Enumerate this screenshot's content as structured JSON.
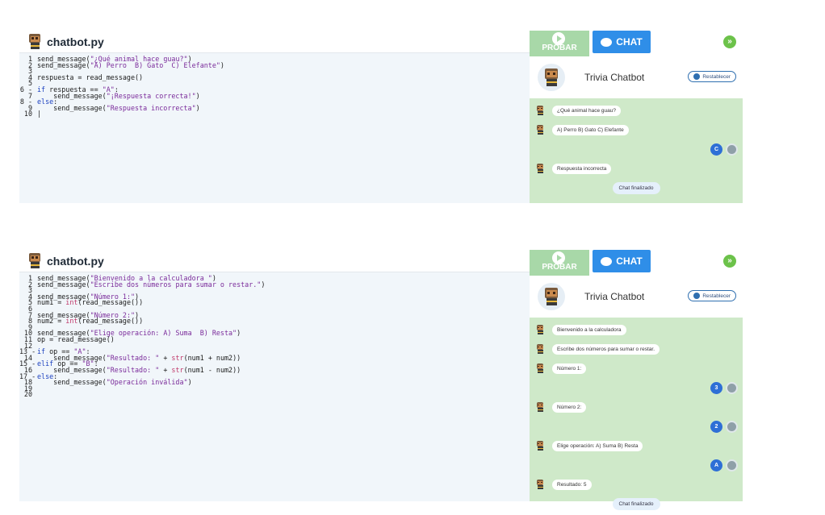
{
  "panels": [
    {
      "file_name": "chatbot.py",
      "code": [
        {
          "n": "1",
          "t": "send_message(\"¿Qué animal hace guau?\")"
        },
        {
          "n": "2",
          "t": "send_message(\"A) Perro  B) Gato  C) Elefante\")"
        },
        {
          "n": "3",
          "t": ""
        },
        {
          "n": "4",
          "t": "respuesta = read_message()"
        },
        {
          "n": "5",
          "t": ""
        },
        {
          "n": "6 -",
          "t": "if respuesta == \"A\":"
        },
        {
          "n": "7",
          "t": "    send_message(\"¡Respuesta correcta!\")"
        },
        {
          "n": "8 -",
          "t": "else:"
        },
        {
          "n": "9",
          "t": "    send_message(\"Respuesta incorrecta\")"
        },
        {
          "n": "10",
          "t": "|"
        }
      ],
      "probar_label": "PROBAR",
      "chat_tab_label": "CHAT",
      "next_icon": "»",
      "bot_title": "Trivia Chatbot",
      "reset_label": "Restablecer",
      "messages": [
        {
          "from": "bot",
          "text": "¿Qué animal hace guau?"
        },
        {
          "from": "bot",
          "text": "A) Perro B) Gato C) Elefante"
        },
        {
          "from": "user",
          "text": "C"
        },
        {
          "from": "bot",
          "text": "Respuesta incorrecta"
        }
      ],
      "end_label": "Chat finalizado"
    },
    {
      "file_name": "chatbot.py",
      "code": [
        {
          "n": "1",
          "t": "send_message(\"Bienvenido a la calculadora \")"
        },
        {
          "n": "2",
          "t": "send_message(\"Escribe dos números para sumar o restar.\")"
        },
        {
          "n": "3",
          "t": ""
        },
        {
          "n": "4",
          "t": "send_message(\"Número 1:\")"
        },
        {
          "n": "5",
          "t": "num1 = int(read_message())"
        },
        {
          "n": "6",
          "t": ""
        },
        {
          "n": "7",
          "t": "send_message(\"Número 2:\")"
        },
        {
          "n": "8",
          "t": "num2 = int(read_message())"
        },
        {
          "n": "9",
          "t": ""
        },
        {
          "n": "10",
          "t": "send_message(\"Elige operación: A) Suma  B) Resta\")"
        },
        {
          "n": "11",
          "t": "op = read_message()"
        },
        {
          "n": "12",
          "t": ""
        },
        {
          "n": "13 -",
          "t": "if op == \"A\":"
        },
        {
          "n": "14",
          "t": "    send_message(\"Resultado: \" + str(num1 + num2))"
        },
        {
          "n": "15 -",
          "t": "elif op == \"B\":"
        },
        {
          "n": "16",
          "t": "    send_message(\"Resultado: \" + str(num1 - num2))"
        },
        {
          "n": "17 -",
          "t": "else:"
        },
        {
          "n": "18",
          "t": "    send_message(\"Operación inválida\")"
        },
        {
          "n": "19",
          "t": ""
        },
        {
          "n": "20",
          "t": ""
        }
      ],
      "probar_label": "PROBAR",
      "chat_tab_label": "CHAT",
      "next_icon": "»",
      "bot_title": "Trivia Chatbot",
      "reset_label": "Restablecer",
      "messages": [
        {
          "from": "bot",
          "text": "Bienvenido a la calculadora"
        },
        {
          "from": "bot",
          "text": "Escribe dos números para sumar o restar."
        },
        {
          "from": "bot",
          "text": "Número 1:"
        },
        {
          "from": "user",
          "text": "3"
        },
        {
          "from": "bot",
          "text": "Número 2:"
        },
        {
          "from": "user",
          "text": "2"
        },
        {
          "from": "bot",
          "text": "Elige operación: A) Suma B) Resta"
        },
        {
          "from": "user",
          "text": "A"
        },
        {
          "from": "bot",
          "text": "Resultado: 5"
        }
      ],
      "end_label": "Chat finalizado"
    }
  ],
  "colors": {
    "chat_tab": "#2f8ee8",
    "probar": "#a8d8a8",
    "next": "#6cc24a",
    "chat_bg": "#cfe9c9",
    "answer_badge": "#2e6fd6"
  },
  "icons": {
    "file_avatar": "robot-avatar-icon",
    "play": "play-icon",
    "chat": "chat-bubble-icon",
    "next": "double-chevron-right-icon",
    "reset": "refresh-icon",
    "user": "user-avatar-icon"
  }
}
